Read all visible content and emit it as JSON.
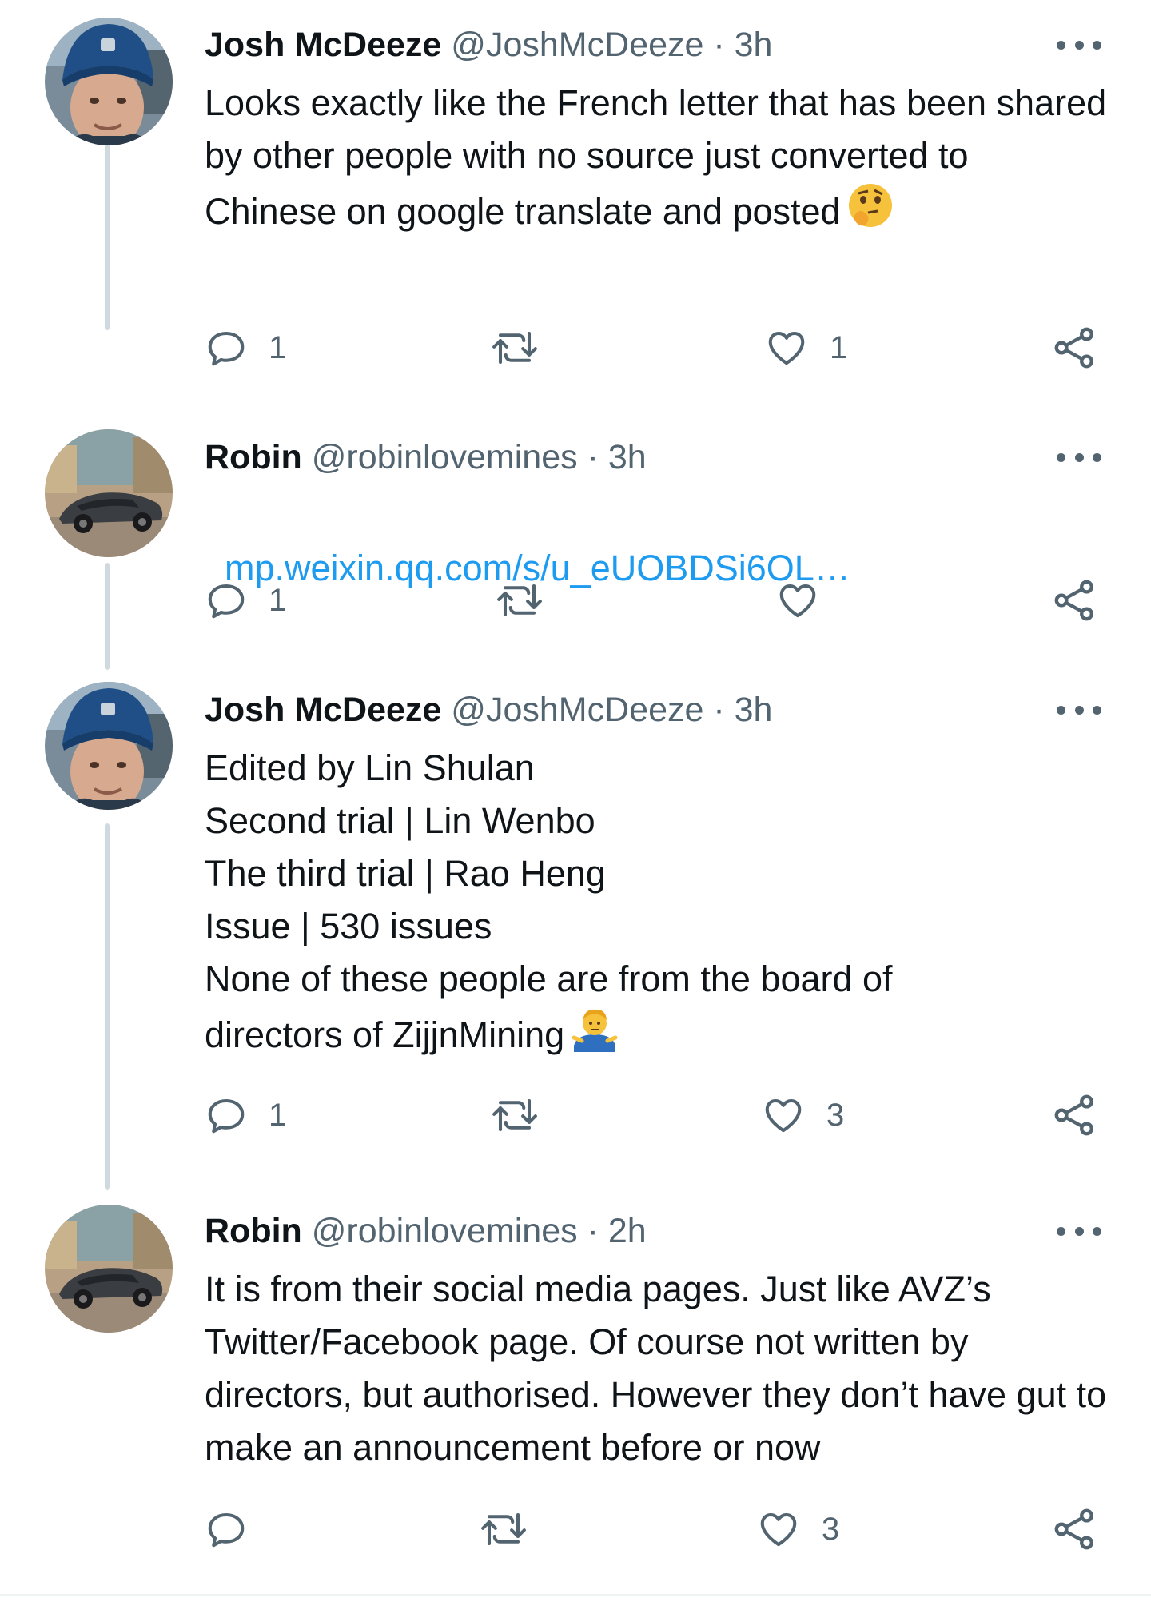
{
  "tweets": [
    {
      "name": "Josh McDeeze",
      "handle": "@JoshMcDeeze",
      "separator": "·",
      "time": "3h",
      "text": "Looks exactly like the French letter that has been shared by other people with no source just converted to Chinese on google translate and posted",
      "emoji": "thinking-face-icon",
      "replies": "1",
      "retweets": "",
      "likes": "1"
    },
    {
      "name": "Robin",
      "handle": "@robinlovemines",
      "separator": "·",
      "time": "3h",
      "link": "mp.weixin.qq.com/s/u_eUOBDSi6OL…",
      "replies": "1",
      "retweets": "",
      "likes": ""
    },
    {
      "name": "Josh McDeeze",
      "handle": "@JoshMcDeeze",
      "separator": "·",
      "time": "3h",
      "lines": [
        "Edited by Lin Shulan",
        "Second trial | Lin Wenbo",
        "The third trial | Rao Heng",
        "Issue | 530 issues",
        "None of these people are from the board of",
        "directors of ZijjnMining"
      ],
      "emoji": "person-shrugging-icon",
      "replies": "1",
      "retweets": "",
      "likes": "3"
    },
    {
      "name": "Robin",
      "handle": "@robinlovemines",
      "separator": "·",
      "time": "2h",
      "text": "It is from their social media pages. Just like AVZ’s Twitter/Facebook page. Of course not written by directors, but authorised. However they don’t have gut to make an announcement before or now",
      "replies": "",
      "retweets": "",
      "likes": "3"
    }
  ],
  "colors": {
    "text": "#0f1419",
    "secondary": "#536471",
    "link": "#1d9bf0",
    "thread_line": "#cfd9de"
  }
}
